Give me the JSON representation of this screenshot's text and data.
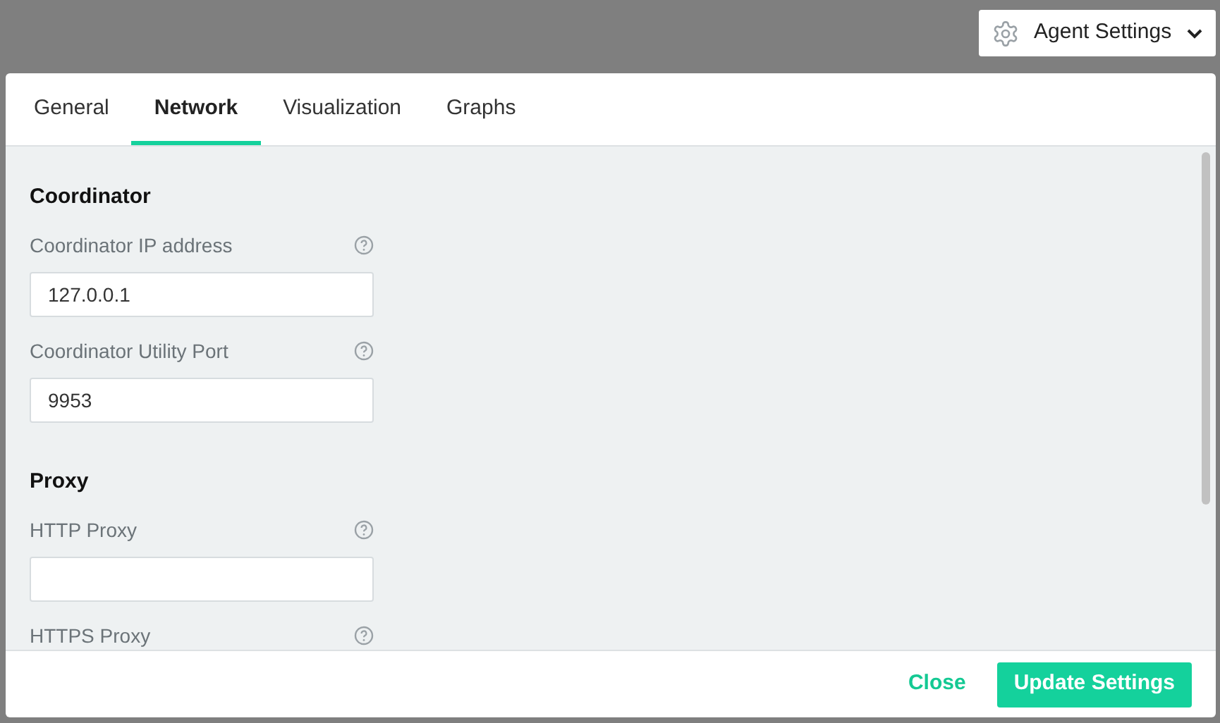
{
  "agent_button": {
    "label": "Agent Settings"
  },
  "tabs": [
    {
      "label": "General",
      "selected": false
    },
    {
      "label": "Network",
      "selected": true
    },
    {
      "label": "Visualization",
      "selected": false
    },
    {
      "label": "Graphs",
      "selected": false
    }
  ],
  "sections": [
    {
      "title": "Coordinator",
      "fields": [
        {
          "kind": "input",
          "label": "Coordinator IP address",
          "value": "127.0.0.1"
        },
        {
          "kind": "input",
          "label": "Coordinator Utility Port",
          "value": "9953"
        }
      ]
    },
    {
      "title": "Proxy",
      "fields": [
        {
          "kind": "input",
          "label": "HTTP Proxy"
        },
        {
          "kind": "label",
          "label": "HTTPS Proxy"
        }
      ]
    }
  ],
  "footer": {
    "close": "Close",
    "update": "Update Settings"
  }
}
